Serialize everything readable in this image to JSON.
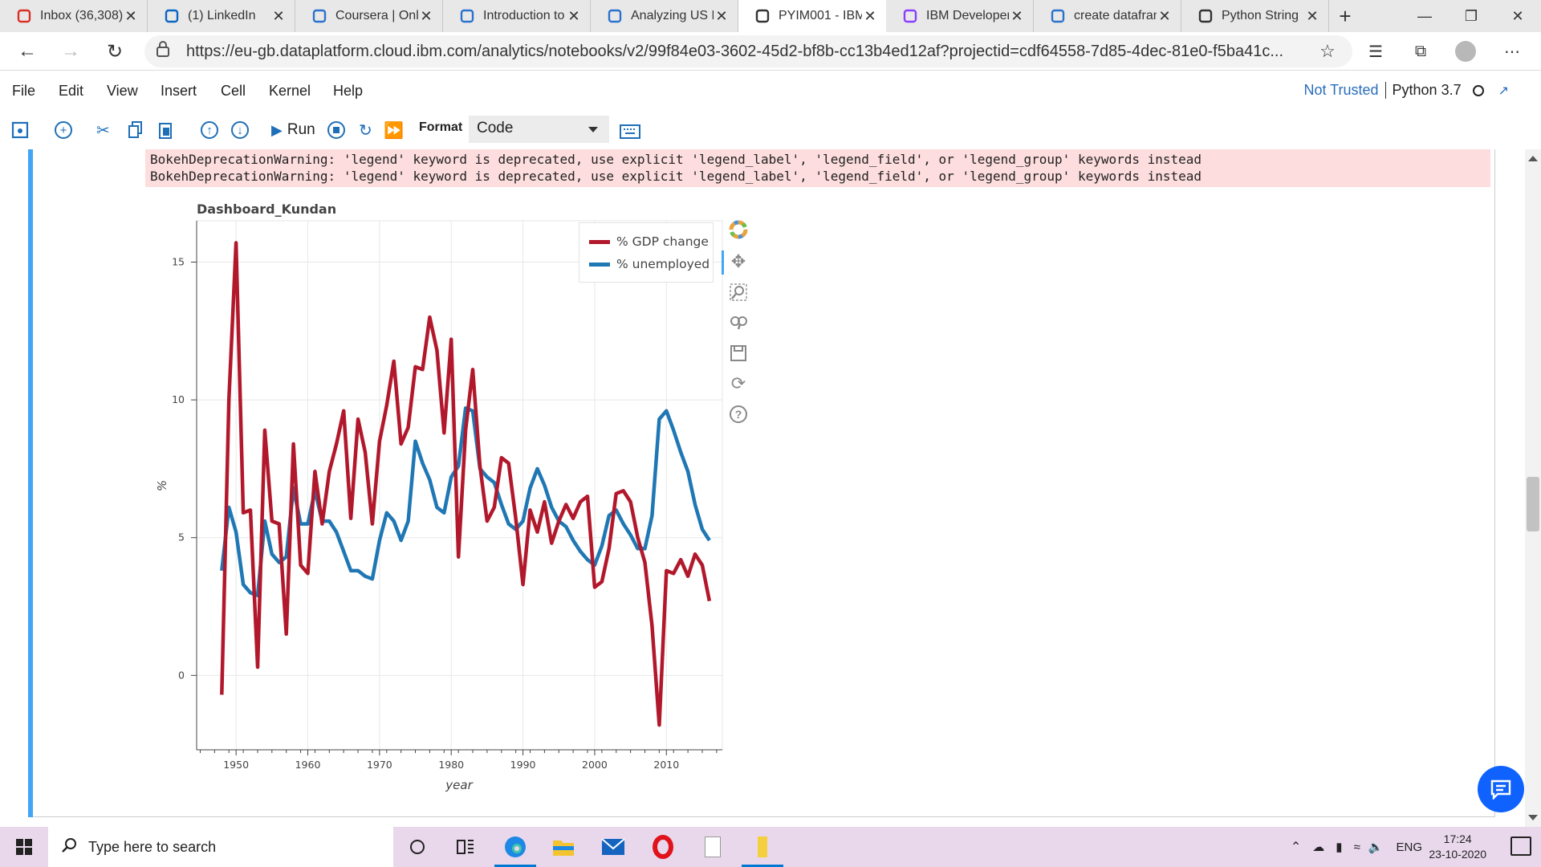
{
  "browser": {
    "tabs": [
      {
        "label": "Inbox (36,308)",
        "icon": "gmail-icon",
        "color": "#d93025"
      },
      {
        "label": "(1) LinkedIn",
        "icon": "linkedin-icon",
        "color": "#0a66c2"
      },
      {
        "label": "Coursera | Onli",
        "icon": "coursera-icon",
        "color": "#2a73cc"
      },
      {
        "label": "Introduction to",
        "icon": "coursera-icon",
        "color": "#2a73cc"
      },
      {
        "label": "Analyzing US E",
        "icon": "coursera-icon",
        "color": "#2a73cc"
      },
      {
        "label": "PYIM001 - IBM",
        "icon": "jupyter-icon",
        "color": "#333333",
        "active": true
      },
      {
        "label": "IBM Developer",
        "icon": "ibm-developer-icon",
        "color": "#8a3ffc"
      },
      {
        "label": "create datafran",
        "icon": "bing-icon",
        "color": "#2a73cc"
      },
      {
        "label": "Python String",
        "icon": "python-diamond-icon",
        "color": "#333333"
      }
    ],
    "url": "https://eu-gb.dataplatform.cloud.ibm.com/analytics/notebooks/v2/99f84e03-3602-45d2-bf8b-cc13b4ed12af?projectid=cdf64558-7d85-4dec-81e0-f5ba41c..."
  },
  "jupyter": {
    "menu": [
      "File",
      "Edit",
      "View",
      "Insert",
      "Cell",
      "Kernel",
      "Help"
    ],
    "trust": "Not Trusted",
    "kernel": "Python 3.7",
    "run_label": "Run",
    "format_label": "Format",
    "cell_type": "Code"
  },
  "output": {
    "warnings": [
      "BokehDeprecationWarning: 'legend' keyword is deprecated, use explicit 'legend_label', 'legend_field', or 'legend_group' keywords instead",
      "BokehDeprecationWarning: 'legend' keyword is deprecated, use explicit 'legend_label', 'legend_field', or 'legend_group' keywords instead"
    ]
  },
  "chart_data": {
    "type": "line",
    "title": "Dashboard_Kundan",
    "xlabel": "year",
    "ylabel": "%",
    "xlim": [
      1944.5,
      2017.8
    ],
    "ylim": [
      -2.7,
      16.5
    ],
    "xticks": [
      1950,
      1960,
      1970,
      1980,
      1990,
      2000,
      2010
    ],
    "yticks": [
      0,
      5,
      10,
      15
    ],
    "grid": true,
    "legend_position": "top-right",
    "x": [
      1948,
      1949,
      1950,
      1951,
      1952,
      1953,
      1954,
      1955,
      1956,
      1957,
      1958,
      1959,
      1960,
      1961,
      1962,
      1963,
      1964,
      1965,
      1966,
      1967,
      1968,
      1969,
      1970,
      1971,
      1972,
      1973,
      1974,
      1975,
      1976,
      1977,
      1978,
      1979,
      1980,
      1981,
      1982,
      1983,
      1984,
      1985,
      1986,
      1987,
      1988,
      1989,
      1990,
      1991,
      1992,
      1993,
      1994,
      1995,
      1996,
      1997,
      1998,
      1999,
      2000,
      2001,
      2002,
      2003,
      2004,
      2005,
      2006,
      2007,
      2008,
      2009,
      2010,
      2011,
      2012,
      2013,
      2014,
      2015,
      2016
    ],
    "series": [
      {
        "name": "% GDP change",
        "color": "#b2182b",
        "values": [
          -0.7,
          10.0,
          15.7,
          5.9,
          6.0,
          0.3,
          8.9,
          5.6,
          5.5,
          1.5,
          8.4,
          4.0,
          3.7,
          7.4,
          5.5,
          7.4,
          8.4,
          9.6,
          5.7,
          9.3,
          8.1,
          5.5,
          8.5,
          9.8,
          11.4,
          8.4,
          9.0,
          11.2,
          11.1,
          13.0,
          11.8,
          8.8,
          12.2,
          4.3,
          8.9,
          11.1,
          7.6,
          5.6,
          6.1,
          7.9,
          7.7,
          5.7,
          3.3,
          6.0,
          5.2,
          6.3,
          4.8,
          5.6,
          6.2,
          5.7,
          6.3,
          6.5,
          3.2,
          3.4,
          4.6,
          6.6,
          6.7,
          6.3,
          5.0,
          4.1,
          1.8,
          -1.8,
          3.8,
          3.7,
          4.2,
          3.6,
          4.4,
          4.0,
          2.7
        ]
      },
      {
        "name": "% unemployed",
        "color": "#1f77b4",
        "values": [
          3.8,
          6.1,
          5.2,
          3.3,
          3.0,
          2.9,
          5.6,
          4.4,
          4.1,
          4.3,
          6.8,
          5.5,
          5.5,
          6.7,
          5.6,
          5.6,
          5.2,
          4.5,
          3.8,
          3.8,
          3.6,
          3.5,
          4.9,
          5.9,
          5.6,
          4.9,
          5.6,
          8.5,
          7.7,
          7.1,
          6.1,
          5.9,
          7.2,
          7.6,
          9.7,
          9.6,
          7.5,
          7.2,
          7.0,
          6.2,
          5.5,
          5.3,
          5.6,
          6.8,
          7.5,
          6.9,
          6.1,
          5.6,
          5.4,
          4.9,
          4.5,
          4.2,
          4.0,
          4.7,
          5.8,
          6.0,
          5.5,
          5.1,
          4.6,
          4.6,
          5.8,
          9.3,
          9.6,
          8.9,
          8.1,
          7.4,
          6.2,
          5.3,
          4.9
        ]
      }
    ]
  },
  "taskbar": {
    "search_placeholder": "Type here to search",
    "language": "ENG",
    "time": "17:24",
    "date": "23-10-2020"
  }
}
